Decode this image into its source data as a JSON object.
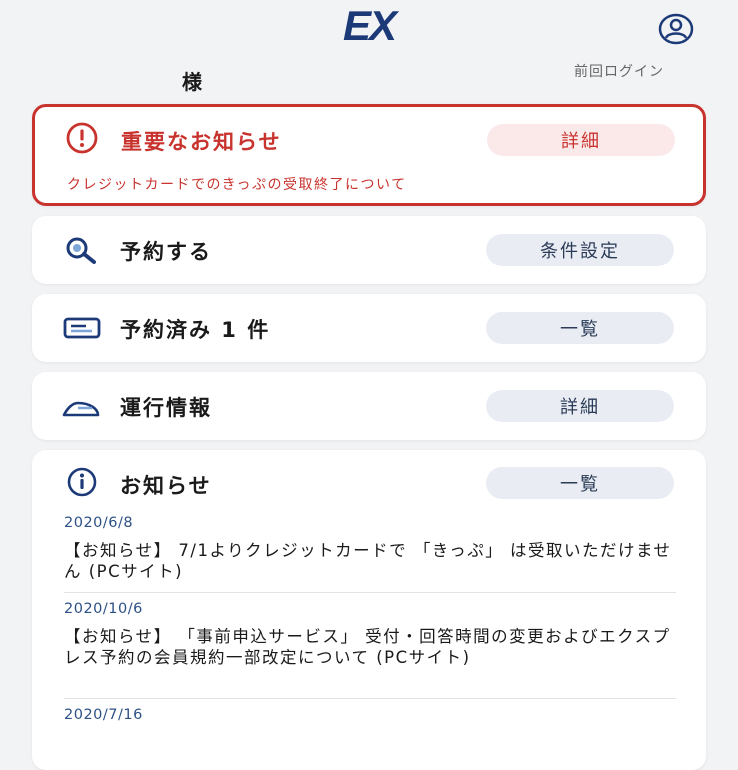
{
  "header": {
    "logo_text": "EX",
    "user_suffix": "様",
    "last_login_label": "前回ログイン",
    "profile_icon": "user-circle-icon"
  },
  "alert": {
    "title": "重要なお知らせ",
    "button": "詳細",
    "message": "クレジットカードでのきっぷの受取終了について",
    "icon": "exclamation-circle-icon",
    "color": "#c8332e"
  },
  "reserve": {
    "title": "予約する",
    "button": "条件設定",
    "icon": "search-icon"
  },
  "reserved": {
    "title": "予約済み 1 件",
    "button": "一覧",
    "icon": "ticket-card-icon"
  },
  "operation": {
    "title": "運行情報",
    "button": "詳細",
    "icon": "train-icon"
  },
  "news": {
    "title": "お知らせ",
    "button": "一覧",
    "icon": "info-circle-icon",
    "items": [
      {
        "date": "2020/6/8",
        "text": "【お知らせ】 7/1よりクレジットカードで 「きっぷ」 は受取いただけません (PCサイト)"
      },
      {
        "date": "2020/10/6",
        "text": "【お知らせ】 「事前申込サービス」 受付・回答時間の変更およびエクスプレス予約の会員規約一部改定について (PCサイト)"
      },
      {
        "date": "2020/7/16",
        "text": ""
      }
    ]
  },
  "colors": {
    "brand": "#1d3a78",
    "accent_red": "#c8332e",
    "pill_bg": "#e9edf3"
  }
}
